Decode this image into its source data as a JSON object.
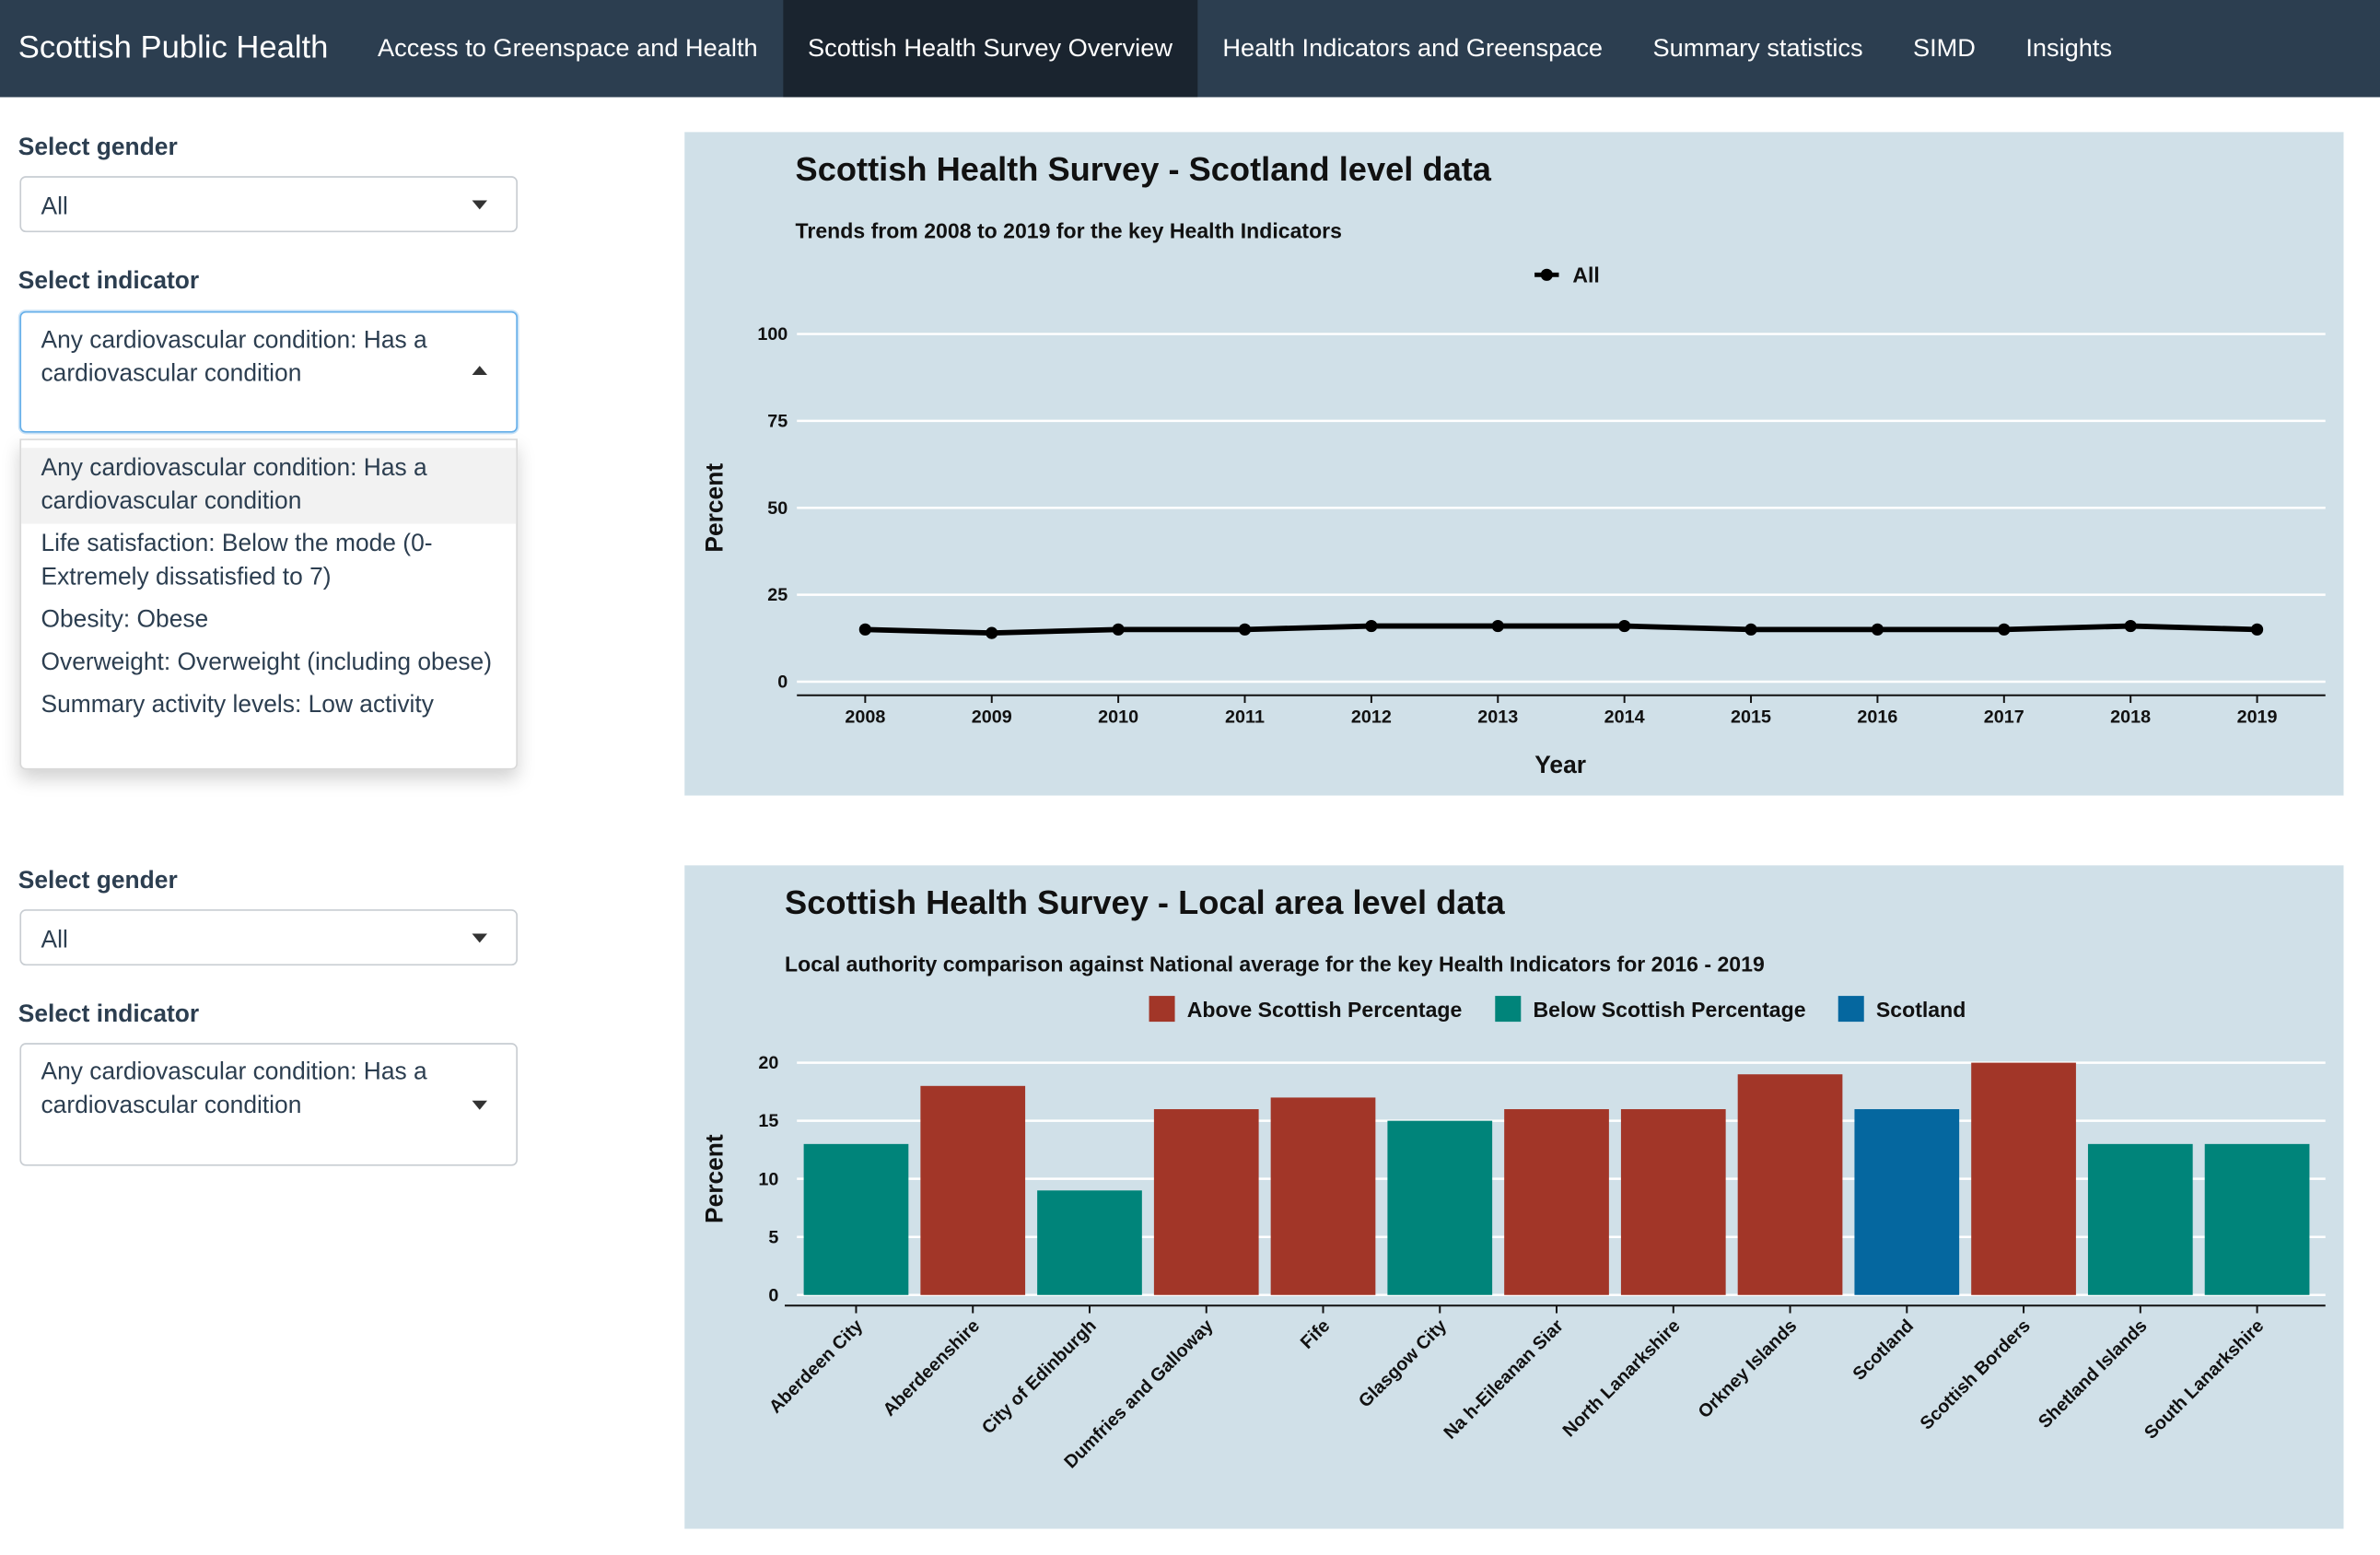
{
  "nav": {
    "brand": "Scottish Public Health",
    "tabs": [
      {
        "label": "Access to Greenspace and Health",
        "active": false
      },
      {
        "label": "Scottish Health Survey Overview",
        "active": true
      },
      {
        "label": "Health Indicators and Greenspace",
        "active": false
      },
      {
        "label": "Summary statistics",
        "active": false
      },
      {
        "label": "SIMD",
        "active": false
      },
      {
        "label": "Insights",
        "active": false
      }
    ]
  },
  "controls_top": {
    "gender_label": "Select gender",
    "gender_value": "All",
    "indicator_label": "Select indicator",
    "indicator_value": "Any cardiovascular condition: Has a cardiovascular condition",
    "indicator_options": [
      "Any cardiovascular condition: Has a cardiovascular condition",
      "Life satisfaction: Below the mode (0-Extremely dissatisfied to 7)",
      "Obesity: Obese",
      "Overweight: Overweight (including obese)",
      "Summary activity levels: Low activity"
    ]
  },
  "controls_bottom": {
    "gender_label": "Select gender",
    "gender_value": "All",
    "indicator_label": "Select indicator",
    "indicator_value": "Any cardiovascular condition: Has a cardiovascular condition"
  },
  "chart_data": [
    {
      "type": "line",
      "title": "Scottish Health Survey - Scotland level data",
      "subtitle": "Trends from 2008 to 2019 for the key Health Indicators",
      "xlabel": "Year",
      "ylabel": "Percent",
      "ylim": [
        0,
        100
      ],
      "yticks": [
        0,
        25,
        50,
        75,
        100
      ],
      "legend_position": "top",
      "grid": true,
      "x": [
        "2008",
        "2009",
        "2010",
        "2011",
        "2012",
        "2013",
        "2014",
        "2015",
        "2016",
        "2017",
        "2018",
        "2019"
      ],
      "series": [
        {
          "name": "All",
          "color": "#000000",
          "values": [
            15,
            14,
            15,
            15,
            16,
            16,
            16,
            15,
            15,
            15,
            16,
            15
          ]
        }
      ]
    },
    {
      "type": "bar",
      "title": "Scottish Health Survey - Local area level data",
      "subtitle": "Local authority comparison against National average for the key Health Indicators for 2016 - 2019",
      "xlabel": "",
      "ylabel": "Percent",
      "ylim": [
        0,
        20
      ],
      "yticks": [
        0,
        5,
        10,
        15,
        20
      ],
      "legend_position": "top",
      "grid": true,
      "legend": [
        {
          "label": "Above Scottish Percentage",
          "color": "#a23628"
        },
        {
          "label": "Below Scottish Percentage",
          "color": "#00847a"
        },
        {
          "label": "Scotland",
          "color": "#05679f"
        }
      ],
      "categories": [
        "Aberdeen City",
        "Aberdeenshire",
        "City of Edinburgh",
        "Dumfries and Galloway",
        "Fife",
        "Glasgow City",
        "Na h-Eileanan Siar",
        "North Lanarkshire",
        "Orkney Islands",
        "Scotland",
        "Scottish Borders",
        "Shetland Islands",
        "South Lanarkshire"
      ],
      "values": [
        13,
        18,
        9,
        16,
        17,
        15,
        16,
        16,
        19,
        16,
        20,
        13,
        13
      ],
      "groups": [
        "Below Scottish Percentage",
        "Above Scottish Percentage",
        "Below Scottish Percentage",
        "Above Scottish Percentage",
        "Above Scottish Percentage",
        "Below Scottish Percentage",
        "Above Scottish Percentage",
        "Above Scottish Percentage",
        "Above Scottish Percentage",
        "Scotland",
        "Above Scottish Percentage",
        "Below Scottish Percentage",
        "Below Scottish Percentage"
      ]
    }
  ]
}
